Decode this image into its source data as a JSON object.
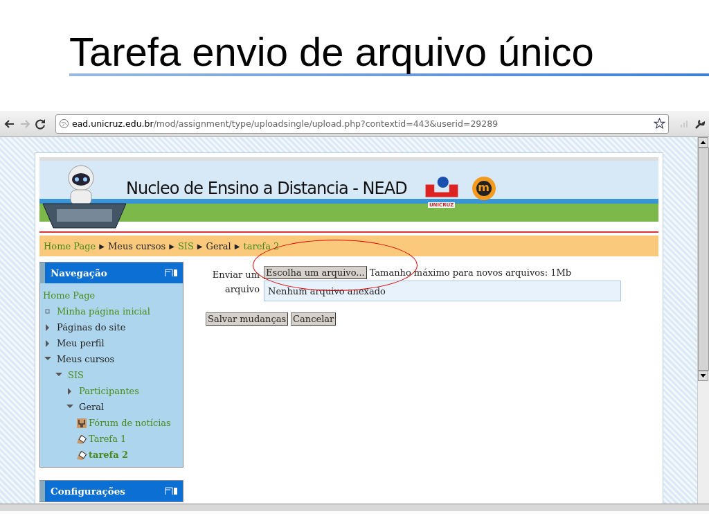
{
  "slide": {
    "title": "Tarefa envio de arquivo único"
  },
  "browser": {
    "url_host": "ead.unicruz.edu.br",
    "url_path": "/mod/assignment/type/uploadsingle/upload.php?contextid=443&userid=29289"
  },
  "banner": {
    "title": "Nucleo de Ensino a Distancia - NEAD",
    "logo_text": "UNICRUZ",
    "moodle_glyph": "m"
  },
  "breadcrumb": {
    "separator": "▶",
    "items": [
      {
        "label": "Home Page",
        "link": true
      },
      {
        "label": "Meus cursos",
        "link": false
      },
      {
        "label": "SIS",
        "link": true
      },
      {
        "label": "Geral",
        "link": false
      },
      {
        "label": "tarefa 2",
        "link": true
      }
    ]
  },
  "blocks": [
    {
      "title": "Navegação",
      "items": [
        {
          "label": "Home Page",
          "kind": "root",
          "link": true,
          "current": false
        },
        {
          "label": "Minha página inicial",
          "kind": "leaf",
          "link": true,
          "current": false
        },
        {
          "label": "Páginas do site",
          "kind": "branch",
          "expanded": false,
          "link": false,
          "current": false
        },
        {
          "label": "Meu perfil",
          "kind": "branch",
          "expanded": false,
          "link": false,
          "current": false
        },
        {
          "label": "Meus cursos",
          "kind": "branch",
          "expanded": true,
          "link": false,
          "current": false,
          "children": [
            {
              "label": "SIS",
              "kind": "branch",
              "expanded": true,
              "link": true,
              "current": false,
              "children": [
                {
                  "label": "Participantes",
                  "kind": "branch",
                  "expanded": false,
                  "link": true,
                  "current": false
                },
                {
                  "label": "Geral",
                  "kind": "branch",
                  "expanded": true,
                  "link": false,
                  "current": false,
                  "children": [
                    {
                      "label": "Fórum de notícias",
                      "kind": "forum",
                      "link": true,
                      "current": false
                    },
                    {
                      "label": "Tarefa 1",
                      "kind": "assignment",
                      "link": true,
                      "current": false
                    },
                    {
                      "label": "tarefa 2",
                      "kind": "assignment",
                      "link": true,
                      "current": true
                    }
                  ]
                }
              ]
            }
          ]
        }
      ]
    },
    {
      "title": "Configurações"
    }
  ],
  "form": {
    "label": "Enviar um arquivo",
    "choose_button": "Escolha um arquivo...",
    "max_size": "Tamanho máximo para novos arquivos: 1Mb",
    "file_status": "Nenhum arquivo anexado",
    "buttons": [
      "Salvar mudanças",
      "Cancelar"
    ]
  }
}
